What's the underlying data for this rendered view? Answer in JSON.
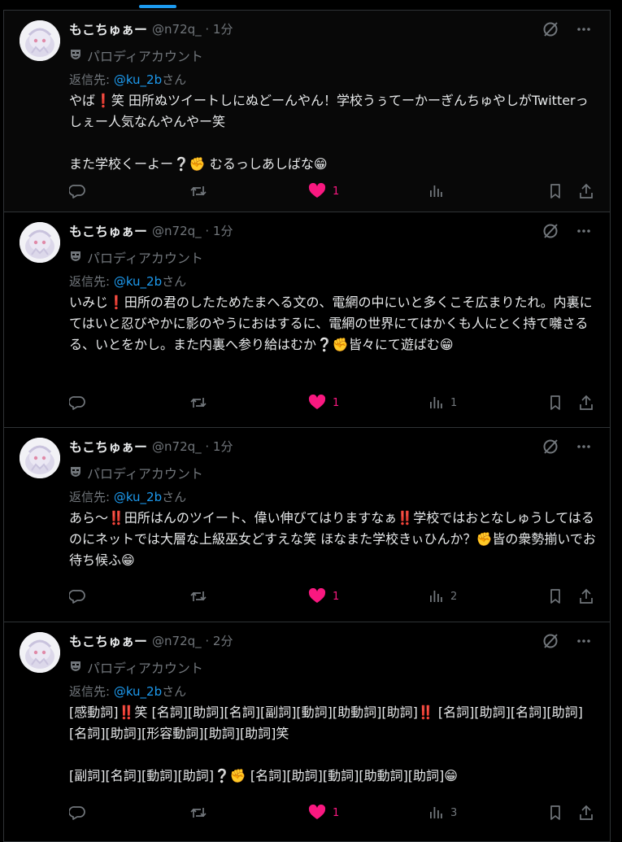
{
  "colors": {
    "accent": "#1d9bf0",
    "like": "#f91880",
    "muted": "#71767b",
    "text": "#e7e9ea"
  },
  "tweets": [
    {
      "name": "もこちゅぁー",
      "handle": "@n72q_ · 1分",
      "label": "パロディアカウント",
      "reply_prefix": "返信先: ",
      "reply_mention": "@ku_2b",
      "reply_suffix": "さん",
      "body": "やば❗️笑 田所ぬツイートしにぬどーんやん！学校うぅてーかーぎんちゅやしがTwitterっしぇー人気なんやんやー笑\n\nまた学校くーよー❔✊ むるっしあしばな😁",
      "likes": "1",
      "views": ""
    },
    {
      "name": "もこちゅぁー",
      "handle": "@n72q_ · 1分",
      "label": "パロディアカウント",
      "reply_prefix": "返信先: ",
      "reply_mention": "@ku_2b",
      "reply_suffix": "さん",
      "body": "いみじ❗️田所の君のしたためたまへる文の、電網の中にいと多くこそ広まりたれ。内裏にてはいと忍びやかに影のやうにおはするに、電網の世界にてはかくも人にとく持て囃さるる、いとをかし。また内裏へ参り給はむか❔✊皆々にて遊ばむ😁",
      "likes": "1",
      "views": "1"
    },
    {
      "name": "もこちゅぁー",
      "handle": "@n72q_ · 1分",
      "label": "パロディアカウント",
      "reply_prefix": "返信先: ",
      "reply_mention": "@ku_2b",
      "reply_suffix": "さん",
      "body": "あら～‼️田所はんのツイート、偉い伸びてはりますなぁ‼️学校ではおとなしゅうしてはるのにネットでは大層な上級巫女どすえな笑 ほなまた学校きぃひんか？✊皆の衆勢揃いでお待ち候ふ😁",
      "likes": "1",
      "views": "2"
    },
    {
      "name": "もこちゅぁー",
      "handle": "@n72q_ · 2分",
      "label": "パロディアカウント",
      "reply_prefix": "返信先: ",
      "reply_mention": "@ku_2b",
      "reply_suffix": "さん",
      "body": "[感動詞]‼️笑 [名詞][助詞][名詞][副詞][動詞][助動詞][助詞]‼️ [名詞][助詞][名詞][助詞][名詞][助詞][形容動詞][助詞][助詞]笑\n\n[副詞][名詞][動詞][助詞]❔✊ [名詞][助詞][動詞][助動詞][助詞]😁",
      "likes": "1",
      "views": "3"
    }
  ]
}
